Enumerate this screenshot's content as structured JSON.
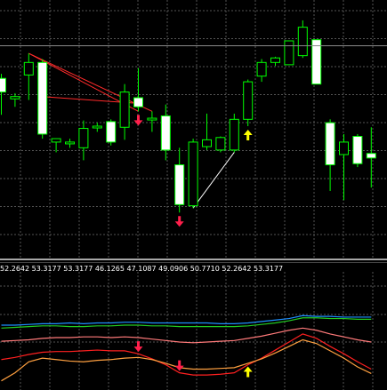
{
  "colors": {
    "background": "#000000",
    "grid": "#555555",
    "candle_outline": "#00ff00",
    "candle_bull_fill": "#000000",
    "candle_bear_fill": "#ffffff",
    "separator": "#dddddd",
    "price_line": "#8a8a8a",
    "trend_red": "#ff2a2a",
    "trend_white": "#ffffff",
    "arrow_down": "#ff1f4b",
    "arrow_up": "#ffff00"
  },
  "main_price_line": {
    "level": 53.3177
  },
  "indicator": {
    "values_text": "52.2642 53.3177 53.3177 46.1265 47.1087 49.0906 50.7710 52.2642 53.3177",
    "lines": [
      {
        "name": "",
        "color": "#1e90ff"
      },
      {
        "name": "",
        "color": "#22cc22"
      },
      {
        "name": "",
        "color": "#ff7a7a"
      },
      {
        "name": "",
        "color": "#ff2020"
      },
      {
        "name": "",
        "color": "#ffa040"
      }
    ]
  },
  "chart_data": {
    "type": "candlestick",
    "ylim": [
      40,
      60
    ],
    "candles": [
      {
        "o": 54.2,
        "h": 54.6,
        "l": 51.0,
        "c": 53.0
      },
      {
        "o": 52.4,
        "h": 52.9,
        "l": 51.7,
        "c": 52.6
      },
      {
        "o": 54.5,
        "h": 56.4,
        "l": 52.3,
        "c": 55.6
      },
      {
        "o": 55.6,
        "h": 55.9,
        "l": 48.9,
        "c": 49.3
      },
      {
        "o": 48.6,
        "h": 48.9,
        "l": 47.7,
        "c": 48.9
      },
      {
        "o": 48.6,
        "h": 48.9,
        "l": 48.1,
        "c": 48.6
      },
      {
        "o": 48.1,
        "h": 50.5,
        "l": 47.0,
        "c": 49.8
      },
      {
        "o": 50.0,
        "h": 50.3,
        "l": 49.5,
        "c": 50.0
      },
      {
        "o": 50.4,
        "h": 50.6,
        "l": 48.3,
        "c": 48.6
      },
      {
        "o": 49.9,
        "h": 53.7,
        "l": 48.8,
        "c": 53.0
      },
      {
        "o": 52.5,
        "h": 55.1,
        "l": 51.3,
        "c": 51.7
      },
      {
        "o": 50.6,
        "h": 51.3,
        "l": 49.5,
        "c": 50.7
      },
      {
        "o": 50.9,
        "h": 51.9,
        "l": 47.0,
        "c": 47.9
      },
      {
        "o": 46.6,
        "h": 48.1,
        "l": 42.4,
        "c": 43.1
      },
      {
        "o": 43.0,
        "h": 48.9,
        "l": 42.8,
        "c": 48.6
      },
      {
        "o": 48.2,
        "h": 51.1,
        "l": 47.9,
        "c": 48.8
      },
      {
        "o": 47.9,
        "h": 49.1,
        "l": 47.7,
        "c": 49.0
      },
      {
        "o": 47.9,
        "h": 51.1,
        "l": 47.7,
        "c": 50.6
      },
      {
        "o": 50.6,
        "h": 54.1,
        "l": 50.0,
        "c": 53.9
      },
      {
        "o": 54.4,
        "h": 55.9,
        "l": 53.9,
        "c": 55.6
      },
      {
        "o": 55.6,
        "h": 56.1,
        "l": 55.3,
        "c": 56.0
      },
      {
        "o": 55.4,
        "h": 57.4,
        "l": 55.4,
        "c": 57.5
      },
      {
        "o": 56.2,
        "h": 59.3,
        "l": 56.0,
        "c": 58.7
      },
      {
        "o": 57.6,
        "h": 57.6,
        "l": 53.7,
        "c": 53.7
      },
      {
        "o": 50.3,
        "h": 50.6,
        "l": 44.3,
        "c": 46.6
      },
      {
        "o": 47.5,
        "h": 49.3,
        "l": 43.5,
        "c": 48.6
      },
      {
        "o": 49.1,
        "h": 49.3,
        "l": 46.4,
        "c": 46.7
      },
      {
        "o": 47.6,
        "h": 49.9,
        "l": 44.6,
        "c": 47.2
      }
    ],
    "signals": [
      {
        "candle": 10,
        "direction": "down"
      },
      {
        "candle": 13,
        "direction": "down"
      },
      {
        "candle": 18,
        "direction": "up"
      }
    ],
    "trend_lines": [
      {
        "from": {
          "candle": 2,
          "value": 56.4
        },
        "to": {
          "candle": 11,
          "value": 51.3
        },
        "color": "trend_red"
      },
      {
        "from": {
          "candle": 2,
          "value": 56.4
        },
        "to": {
          "candle": 10,
          "value": 51.3
        },
        "color": "trend_red"
      },
      {
        "from": {
          "candle": 3,
          "value": 52.6
        },
        "to": {
          "candle": 10,
          "value": 52.0
        },
        "color": "trend_red"
      },
      {
        "from": {
          "candle": 14,
          "value": 42.8
        },
        "to": {
          "candle": 17,
          "value": 47.7
        },
        "color": "trend_white"
      }
    ],
    "indicator_series": [
      {
        "name": "",
        "values": [
          52,
          52,
          52.1,
          52.2,
          52.2,
          52.3,
          52.2,
          52.3,
          52.3,
          52.4,
          52.4,
          52.3,
          52.3,
          52.3,
          52.3,
          52.3,
          52.2,
          52.2,
          52.3,
          52.5,
          52.7,
          52.9,
          53.3,
          53.2,
          53.2,
          53.1,
          53.1,
          53.1
        ]
      },
      {
        "name": "",
        "values": [
          51.6,
          51.7,
          51.8,
          51.9,
          51.9,
          51.8,
          51.8,
          51.9,
          51.9,
          52.0,
          52.0,
          51.9,
          51.9,
          51.8,
          51.8,
          51.8,
          51.8,
          51.8,
          51.9,
          52.1,
          52.3,
          52.6,
          53.0,
          53.0,
          52.9,
          52.9,
          52.8,
          52.8
        ]
      },
      {
        "name": "",
        "values": [
          49.8,
          49.9,
          50.0,
          50.2,
          50.3,
          50.3,
          50.4,
          50.4,
          50.3,
          50.4,
          50.3,
          50.1,
          49.9,
          49.7,
          49.6,
          49.7,
          49.8,
          49.9,
          50.2,
          50.5,
          50.9,
          51.3,
          51.6,
          51.3,
          50.8,
          50.4,
          50.0,
          49.7
        ]
      },
      {
        "name": "",
        "values": [
          47.3,
          47.6,
          48.0,
          48.3,
          48.4,
          48.4,
          48.5,
          48.6,
          48.5,
          48.5,
          48.1,
          47.4,
          46.6,
          45.5,
          45.2,
          45.2,
          45.3,
          45.5,
          46.6,
          47.5,
          48.6,
          49.7,
          50.8,
          50.2,
          49.1,
          48.1,
          47.0,
          46.0
        ]
      },
      {
        "name": "",
        "values": [
          44.4,
          45.5,
          47.0,
          47.5,
          47.3,
          47.1,
          47.0,
          47.2,
          47.3,
          47.5,
          47.6,
          47.3,
          46.8,
          46.2,
          46.0,
          46.0,
          46.1,
          46.2,
          46.8,
          47.4,
          48.2,
          49.1,
          50.0,
          49.5,
          48.5,
          47.5,
          46.3,
          45.4
        ]
      }
    ],
    "indicator_ylim": [
      40,
      60
    ]
  }
}
